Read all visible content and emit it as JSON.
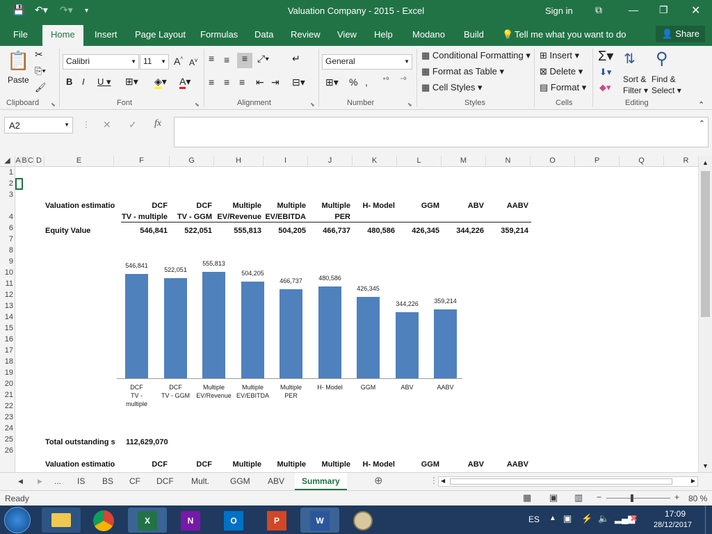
{
  "window": {
    "title": "Valuation Company - 2015  -  Excel",
    "sign_in": "Sign in"
  },
  "ribbon_tabs": [
    "File",
    "Home",
    "Insert",
    "Page Layout",
    "Formulas",
    "Data",
    "Review",
    "View",
    "Help",
    "Modano",
    "Build"
  ],
  "tell_me": "Tell me what you want to do",
  "share_label": "Share",
  "ribbon": {
    "clipboard": {
      "paste": "Paste",
      "label": "Clipboard"
    },
    "font": {
      "name": "Calibri",
      "size": "11",
      "label": "Font"
    },
    "alignment": {
      "label": "Alignment"
    },
    "number": {
      "format": "General",
      "label": "Number"
    },
    "styles": {
      "conditional": "Conditional Formatting",
      "format_table": "Format as Table",
      "cell_styles": "Cell Styles",
      "label": "Styles"
    },
    "cells": {
      "insert": "Insert",
      "delete": "Delete",
      "format": "Format",
      "label": "Cells"
    },
    "editing": {
      "sort": "Sort &",
      "filter": "Filter",
      "find": "Find &",
      "select": "Select",
      "label": "Editing"
    }
  },
  "formula_bar": {
    "name_box": "A2",
    "fx": "fx",
    "content": ""
  },
  "columns": [
    "A",
    "B",
    "C",
    "D",
    "E",
    "F",
    "G",
    "H",
    "I",
    "J",
    "K",
    "L",
    "M",
    "N",
    "O",
    "P",
    "Q",
    "R"
  ],
  "rows": [
    "1",
    "2",
    "3",
    "4",
    "6",
    "7",
    "8",
    "9",
    "10",
    "11",
    "12",
    "13",
    "14",
    "15",
    "16",
    "17",
    "18",
    "19",
    "20",
    "21",
    "22",
    "23",
    "24",
    "25",
    "26"
  ],
  "table": {
    "title": "Valuation estimation",
    "headers": [
      {
        "l1": "DCF",
        "l2": "TV - multiple"
      },
      {
        "l1": "DCF",
        "l2": "TV - GGM"
      },
      {
        "l1": "Multiple",
        "l2": "EV/Revenue"
      },
      {
        "l1": "Multiple",
        "l2": "EV/EBITDA"
      },
      {
        "l1": "Multiple",
        "l2": "PER"
      },
      {
        "l1": "H- Model",
        "l2": ""
      },
      {
        "l1": "GGM",
        "l2": ""
      },
      {
        "l1": "ABV",
        "l2": ""
      },
      {
        "l1": "AABV",
        "l2": ""
      }
    ],
    "row_label": "Equity Value",
    "values": [
      "546,841",
      "522,051",
      "555,813",
      "504,205",
      "466,737",
      "480,586",
      "426,345",
      "344,226",
      "359,214"
    ]
  },
  "chart_data": {
    "type": "bar",
    "categories": [
      "DCF TV - multiple",
      "DCF TV - GGM",
      "Multiple EV/Revenue",
      "Multiple EV/EBITDA",
      "Multiple PER",
      "H- Model",
      "GGM",
      "ABV",
      "AABV"
    ],
    "values": [
      546841,
      522051,
      555813,
      504205,
      466737,
      480586,
      426345,
      344226,
      359214
    ],
    "data_labels": [
      "546,841",
      "522,051",
      "555,813",
      "504,205",
      "466,737",
      "480,586",
      "426,345",
      "344,226",
      "359,214"
    ],
    "x_labels": [
      [
        "DCF",
        "TV -",
        "multiple"
      ],
      [
        "DCF",
        "TV - GGM"
      ],
      [
        "Multiple",
        "EV/Revenue"
      ],
      [
        "Multiple",
        "EV/EBITDA"
      ],
      [
        "Multiple",
        "PER"
      ],
      [
        "H- Model"
      ],
      [
        "GGM"
      ],
      [
        "ABV"
      ],
      [
        "AABV"
      ]
    ],
    "title": "",
    "xlabel": "",
    "ylabel": "",
    "ylim": [
      0,
      600000
    ],
    "legend": "none",
    "grid": false,
    "color": "#4f81bd"
  },
  "shares": {
    "label": "Total outstanding sh",
    "value": "112,629,070"
  },
  "table2": {
    "title": "Valuation estimation",
    "headers": [
      "DCF",
      "DCF",
      "Multiple",
      "Multiple",
      "Multiple",
      "H- Model",
      "GGM",
      "ABV",
      "AABV"
    ]
  },
  "sheet_tabs": [
    "...",
    "IS",
    "BS",
    "CF",
    "DCF",
    "Mult.",
    "GGM",
    "ABV",
    "Summary"
  ],
  "active_sheet": "Summary",
  "status": {
    "ready": "Ready",
    "zoom": "80 %"
  },
  "taskbar": {
    "lang": "ES",
    "time": "17:09",
    "date": "28/12/2017"
  },
  "colors": {
    "excel_green": "#217346",
    "bar_blue": "#4f81bd"
  }
}
